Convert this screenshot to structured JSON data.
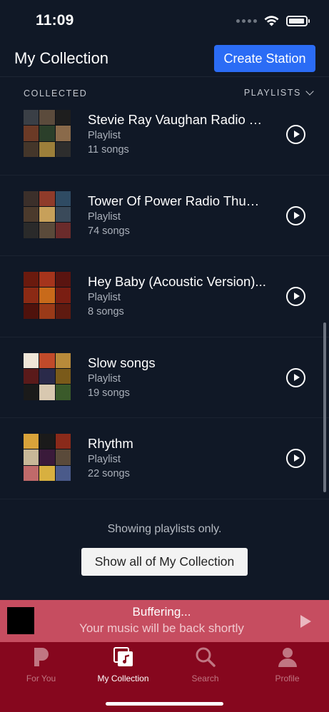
{
  "status_bar": {
    "time": "11:09"
  },
  "header": {
    "title": "My Collection",
    "create_button": "Create Station"
  },
  "filter": {
    "collected_label": "COLLECTED",
    "playlists_label": "PLAYLISTS"
  },
  "items": [
    {
      "title": "Stevie Ray Vaughan Radio T...",
      "type": "Playlist",
      "count": "11 songs",
      "art_colors": [
        "#3a3f46",
        "#5b4b3c",
        "#1e1e1e",
        "#6b3a26",
        "#2b3f2a",
        "#8a6a4a",
        "#44362a",
        "#9c7f3a",
        "#2d2d2d"
      ]
    },
    {
      "title": "Tower Of Power Radio Thum...",
      "type": "Playlist",
      "count": "74 songs",
      "art_colors": [
        "#3b2f2a",
        "#8f3b2a",
        "#2f4b63",
        "#4b3a2c",
        "#c7a05a",
        "#3a4a5a",
        "#2a2a2a",
        "#5a4a3a",
        "#6a2b2b"
      ]
    },
    {
      "title": "Hey Baby (Acoustic Version)...",
      "type": "Playlist",
      "count": "8 songs",
      "art_colors": [
        "#6a1a0e",
        "#a5341c",
        "#5a1410",
        "#8b2a14",
        "#c86a1a",
        "#7a1e12",
        "#4f120c",
        "#9a3a18",
        "#5e1a10"
      ]
    },
    {
      "title": "Slow songs",
      "type": "Playlist",
      "count": "19 songs",
      "art_colors": [
        "#f0e6d8",
        "#c14a2a",
        "#b88a3a",
        "#5a1a1a",
        "#2a2a4a",
        "#7a5a1a",
        "#1a1a1a",
        "#d8c8b0",
        "#3a5a2a"
      ]
    },
    {
      "title": "Rhythm",
      "type": "Playlist",
      "count": "22 songs",
      "art_colors": [
        "#d9a33a",
        "#1a1a1a",
        "#8a2a1a",
        "#c8b898",
        "#3a1a3a",
        "#5a4a3a",
        "#c06a6a",
        "#d8b040",
        "#4a5a8a"
      ]
    }
  ],
  "footer": {
    "showing_text": "Showing playlists only.",
    "show_all_button": "Show all of My Collection"
  },
  "mini_player": {
    "title": "Buffering...",
    "subtitle": "Your music will be back shortly"
  },
  "tabs": [
    {
      "label": "For You",
      "icon": "pandora-icon"
    },
    {
      "label": "My Collection",
      "icon": "collection-icon"
    },
    {
      "label": "Search",
      "icon": "search-icon"
    },
    {
      "label": "Profile",
      "icon": "profile-icon"
    }
  ]
}
